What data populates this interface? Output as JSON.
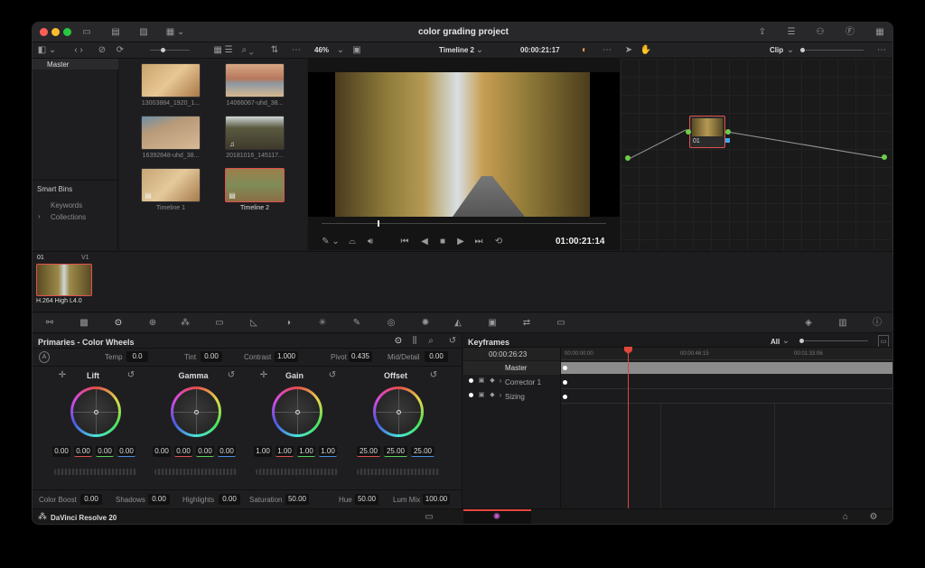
{
  "window": {
    "title": "color grading project"
  },
  "media_pool": {
    "root": "Master",
    "smart_bins_label": "Smart Bins",
    "bins": [
      "Keywords",
      "Collections"
    ],
    "clips": [
      {
        "name": "13003884_1920_1...",
        "color": "#c9a36b"
      },
      {
        "name": "14066067-uhd_38...",
        "color": "#b78b6c"
      },
      {
        "name": "16392848-uhd_38...",
        "color": "#b99a78"
      },
      {
        "name": "20181016_145117...",
        "color": "#5a5a40"
      },
      {
        "name": "Timeline 1",
        "color": "#c7a574"
      },
      {
        "name": "Timeline 2",
        "color": "#7f8c58"
      }
    ]
  },
  "viewer": {
    "zoom": "46%",
    "timeline": "Timeline 2",
    "timecode_top": "00:00:21:17",
    "timecode": "01:00:21:14"
  },
  "nodes": {
    "mode": "Clip",
    "node_label": "01"
  },
  "clip_strip": {
    "index": "01",
    "track": "V1",
    "codec": "H.264 High L4.0"
  },
  "primaries": {
    "title": "Primaries - Color Wheels",
    "temp_label": "Temp",
    "temp": "0.0",
    "tint_label": "Tint",
    "tint": "0.00",
    "contrast_label": "Contrast",
    "contrast": "1.000",
    "pivot_label": "Pivot",
    "pivot": "0.435",
    "middetail_label": "Mid/Detail",
    "middetail": "0.00",
    "wheels": [
      {
        "name": "Lift",
        "values": [
          "0.00",
          "0.00",
          "0.00",
          "0.00"
        ]
      },
      {
        "name": "Gamma",
        "values": [
          "0.00",
          "0.00",
          "0.00",
          "0.00"
        ]
      },
      {
        "name": "Gain",
        "values": [
          "1.00",
          "1.00",
          "1.00",
          "1.00"
        ]
      },
      {
        "name": "Offset",
        "values": [
          "25.00",
          "25.00",
          "25.00"
        ]
      }
    ],
    "bottom": [
      {
        "label": "Color Boost",
        "value": "0.00"
      },
      {
        "label": "Shadows",
        "value": "0.00"
      },
      {
        "label": "Highlights",
        "value": "0.00"
      },
      {
        "label": "Saturation",
        "value": "50.00"
      },
      {
        "label": "Hue",
        "value": "50.00"
      },
      {
        "label": "Lum Mix",
        "value": "100.00"
      }
    ]
  },
  "keyframes": {
    "title": "Keyframes",
    "filter": "All",
    "timecode": "00:00:26:23",
    "ruler": [
      "00:00:00:00",
      "00:00:46:15",
      "00:01:33:06"
    ],
    "tracks": [
      "Master",
      "Corrector 1",
      "Sizing"
    ]
  },
  "footer": {
    "app": "DaVinci Resolve 20"
  }
}
